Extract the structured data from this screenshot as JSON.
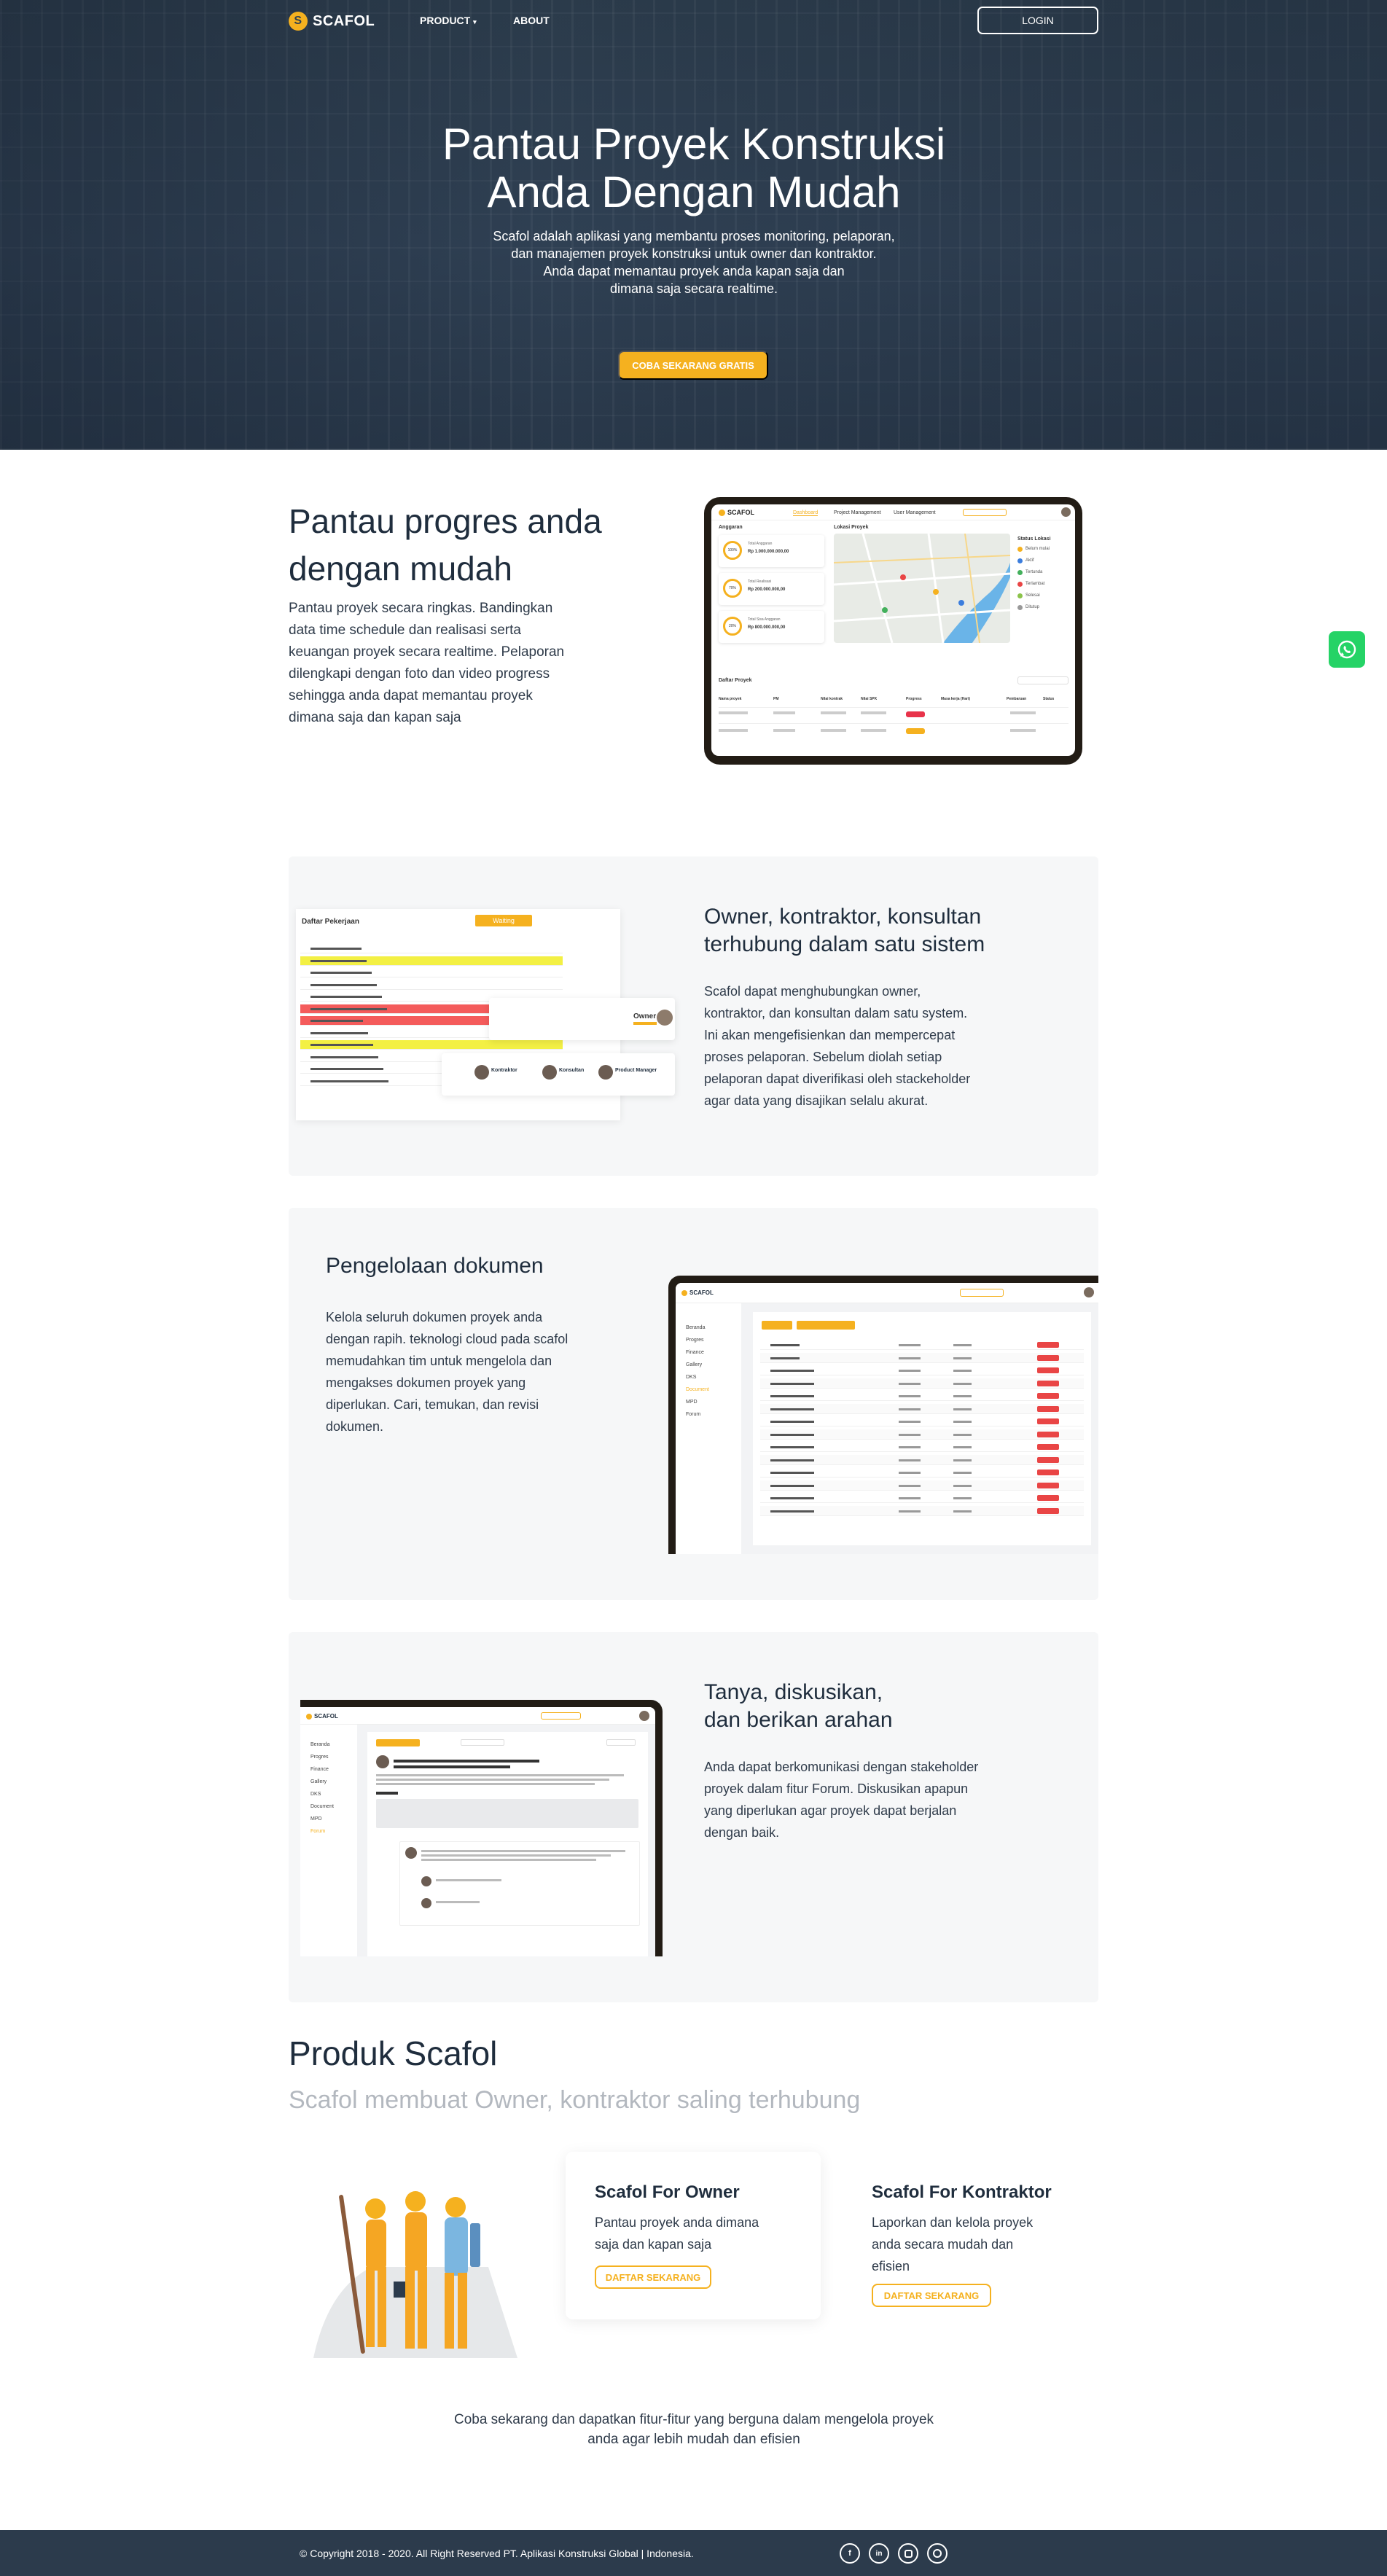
{
  "nav": {
    "logo": "SCAFOL",
    "product": "PRODUCT",
    "about": "ABOUT",
    "login": "LOGIN"
  },
  "hero": {
    "title_line1": "Pantau Proyek Konstruksi",
    "title_line2": "Anda Dengan Mudah",
    "sub_line1": "Scafol adalah aplikasi yang membantu proses monitoring, pelaporan,",
    "sub_line2": "dan manajemen proyek konstruksi untuk owner dan kontraktor.",
    "sub_line3": "Anda dapat memantau proyek anda kapan saja dan",
    "sub_line4": "dimana saja secara realtime.",
    "cta": "COBA SEKARANG GRATIS"
  },
  "feature1": {
    "title_line1": "Pantau progres anda",
    "title_line2": "dengan mudah",
    "text_lines": [
      "Pantau proyek secara ringkas. Bandingkan",
      "data time schedule dan realisasi serta",
      "keuangan proyek secara realtime. Pelaporan",
      "dilengkapi dengan foto dan video progress",
      "sehingga anda dapat memantau proyek",
      "dimana saja dan kapan saja"
    ],
    "mock": {
      "logo": "SCAFOL",
      "menu": [
        "Dashboard",
        "Project Management",
        "User Management"
      ],
      "anggaran": "Anggaran",
      "lokasi": "Lokasi Proyek",
      "daftar": "Daftar Proyek",
      "cards": [
        {
          "pct": "100%",
          "label": "Total Anggaran",
          "value": "Rp 1.000.000.000,00"
        },
        {
          "pct": "70%",
          "label": "Total Realisasi",
          "value": "Rp 200.000.000,00"
        },
        {
          "pct": "20%",
          "label": "Total Sisa Anggaran",
          "value": "Rp 800.000.000,00"
        }
      ],
      "legend_title": "Status Lokasi",
      "legend": [
        "Belum mulai",
        "Aktif",
        "Tertunda",
        "Terlambat",
        "Selesai",
        "Ditutup"
      ],
      "columns": [
        "Nama proyek",
        "PM",
        "Nilai kontrak",
        "Nilai SPK",
        "Progress",
        "Masa kerja (Hari)",
        "Pembaruan",
        "Status"
      ]
    }
  },
  "feature2": {
    "title_line1": "Owner, kontraktor, konsultan",
    "title_line2": "terhubung dalam satu sistem",
    "text_lines": [
      "Scafol dapat menghubungkan owner,",
      "kontraktor, dan konsultan dalam satu system.",
      "Ini akan mengefisienkan dan mempercepat",
      "proses pelaporan. Sebelum diolah setiap",
      "pelaporan dapat diverifikasi oleh stackeholder",
      " agar data yang disajikan selalu akurat."
    ],
    "mock": {
      "title": "Daftar Pekerjaan",
      "badge": "Waiting",
      "owner": "Owner",
      "roles": [
        "Kontraktor",
        "Konsultan",
        "Product Manager"
      ]
    }
  },
  "feature3": {
    "title": "Pengelolaan dokumen",
    "text_lines": [
      "Kelola seluruh dokumen proyek anda",
      "dengan rapih. teknologi cloud pada scafol",
      "memudahkan tim untuk mengelola dan",
      "mengakses dokumen proyek yang",
      "diperlukan. Cari, temukan, dan revisi",
      "dokumen."
    ],
    "mock": {
      "logo": "SCAFOL",
      "sidebar": [
        "Beranda",
        "Progres",
        "Finance",
        "Gallery",
        "DKS",
        "Document",
        "MPD",
        "Forum"
      ]
    }
  },
  "feature4": {
    "title_line1": "Tanya, diskusikan,",
    "title_line2": "dan berikan arahan",
    "text_lines": [
      "Anda dapat berkomunikasi dengan stakeholder",
      "proyek dalam fitur Forum. Diskusikan apapun",
      "yang diperlukan agar proyek dapat berjalan",
      "dengan baik."
    ],
    "mock": {
      "logo": "SCAFOL",
      "sidebar": [
        "Beranda",
        "Progres",
        "Finance",
        "Gallery",
        "DKS",
        "Document",
        "MPD",
        "Forum"
      ]
    }
  },
  "products": {
    "title": "Produk Scafol",
    "subtitle": "Scafol membuat Owner, kontraktor saling terhubung",
    "owner": {
      "title": "Scafol For Owner",
      "text_line1": "Pantau proyek anda dimana",
      "text_line2": "saja dan kapan saja",
      "button": "DAFTAR SEKARANG"
    },
    "kontraktor": {
      "title": "Scafol For Kontraktor",
      "text_line1": "Laporkan dan kelola proyek",
      "text_line2": "anda secara mudah dan",
      "text_line3": "efisien",
      "button": "DAFTAR SEKARANG"
    },
    "closing_line1": "Coba sekarang dan dapatkan fitur-fitur yang berguna dalam mengelola proyek",
    "closing_line2": "anda agar lebih mudah dan efisien"
  },
  "footer": {
    "copyright": "© Copyright 2018 - 2020. All Right Reserved PT. Aplikasi Konstruksi Global | Indonesia."
  },
  "colors": {
    "accent": "#f5b11f",
    "navy": "#2c3b4c",
    "whatsapp": "#25d366"
  }
}
